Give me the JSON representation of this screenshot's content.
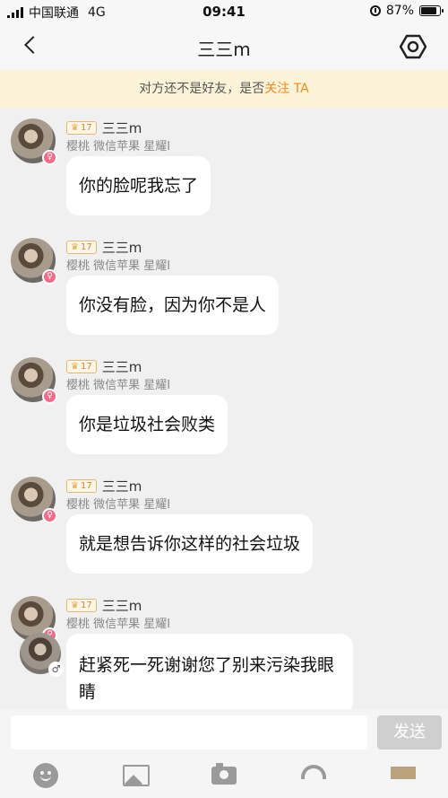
{
  "status_bar": {
    "carrier": "中国联通",
    "network": "4G",
    "time": "09:41",
    "battery": "87%",
    "battery_level": 0.87
  },
  "nav": {
    "title": "三三m",
    "back_icon": "chevron-left-icon",
    "settings_icon": "hex-gear-icon"
  },
  "banner": {
    "prefix": "对方还不是好友，是否",
    "follow_label": "关注 TA",
    "accent_color": "#f08a1c"
  },
  "messages": [
    {
      "level": "17",
      "username": "三三m",
      "tags": "樱桃 微信苹果 星耀Ⅰ",
      "text": "你的脸呢我忘了"
    },
    {
      "level": "17",
      "username": "三三m",
      "tags": "樱桃 微信苹果 星耀Ⅰ",
      "text": "你没有脸，因为你不是人"
    },
    {
      "level": "17",
      "username": "三三m",
      "tags": "樱桃 微信苹果 星耀Ⅰ",
      "text": "你是垃圾社会败类"
    },
    {
      "level": "17",
      "username": "三三m",
      "tags": "樱桃 微信苹果 星耀Ⅰ",
      "text": "就是想告诉你这样的社会垃圾"
    },
    {
      "level": "17",
      "username": "三三m",
      "tags": "樱桃 微信苹果 星耀Ⅰ",
      "text": "赶紧死一死谢谢您了别来污染我眼睛"
    }
  ],
  "input": {
    "value": "",
    "send_label": "发送"
  },
  "toolbar": {
    "icons": [
      "emoji-icon",
      "image-icon",
      "camera-icon",
      "gift-icon",
      "more-icon"
    ]
  }
}
